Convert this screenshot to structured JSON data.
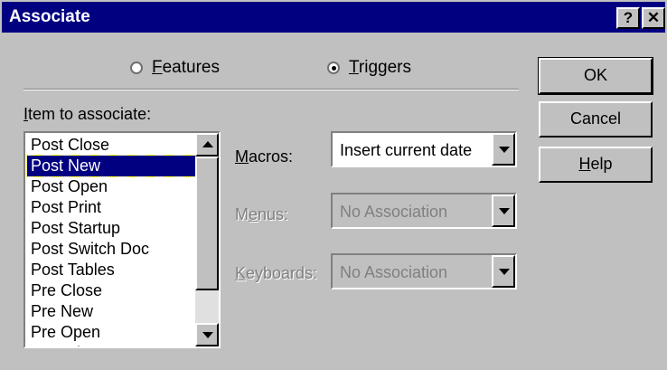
{
  "window": {
    "title": "Associate",
    "help_glyph": "?",
    "close_glyph": "✕"
  },
  "mode": {
    "features": {
      "prefix": "",
      "mnemonic": "F",
      "rest": "eatures",
      "selected": false
    },
    "triggers": {
      "prefix": "",
      "mnemonic": "T",
      "rest": "riggers",
      "selected": true
    }
  },
  "item_label": {
    "prefix": "",
    "mnemonic": "I",
    "rest": "tem to associate:"
  },
  "items": [
    "Post Close",
    "Post New",
    "Post Open",
    "Post Print",
    "Post Startup",
    "Post Switch Doc",
    "Post Tables",
    "Pre Close",
    "Pre New",
    "Pre Open",
    "Pre Print"
  ],
  "selected_item": "Post New",
  "associations": {
    "macros": {
      "prefix": "",
      "mnemonic": "M",
      "rest": "acros:",
      "value": "Insert current date",
      "enabled": true
    },
    "menus": {
      "prefix": "M",
      "mnemonic": "e",
      "rest": "nus:",
      "value": "No Association",
      "enabled": false
    },
    "keyboards": {
      "prefix": "",
      "mnemonic": "K",
      "rest": "eyboards:",
      "value": "No Association",
      "enabled": false
    }
  },
  "buttons": {
    "ok": {
      "prefix": "OK",
      "mnemonic": "",
      "rest": ""
    },
    "cancel": {
      "prefix": "Cancel",
      "mnemonic": "",
      "rest": ""
    },
    "help": {
      "prefix": "",
      "mnemonic": "H",
      "rest": "elp"
    }
  },
  "colors": {
    "face": "#c0c0c0",
    "titlebar": "#000080",
    "selection": "#000080",
    "disabled_text": "#808080"
  }
}
